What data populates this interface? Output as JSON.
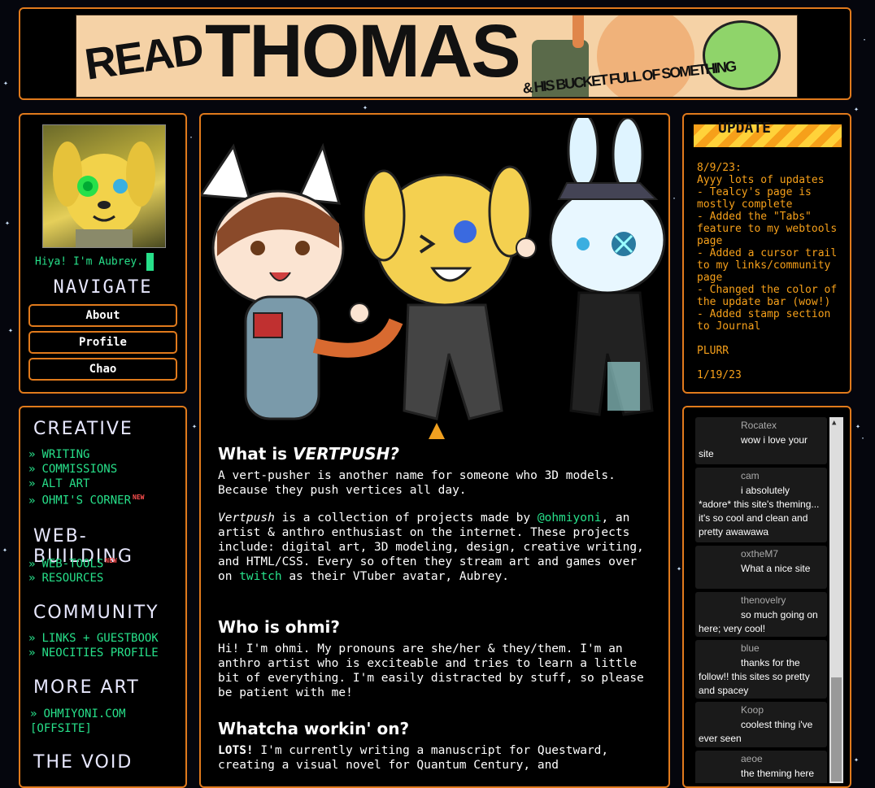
{
  "banner": {
    "read": "READ",
    "thomas": "THOMAS",
    "subtitle": "& HIS BUCKET FULL OF SOMETHING"
  },
  "sidebar": {
    "greeting": "Hiya! I'm Aubrey.",
    "nav_title": "NAVIGATE",
    "nav_buttons": [
      "About",
      "Profile",
      "Chao"
    ]
  },
  "links": {
    "creative_title": "CREATIVE",
    "creative": [
      "WRITING",
      "COMMISSIONS",
      "ALT ART",
      "OHMI'S CORNER"
    ],
    "web_title": "WEB-BUILDING",
    "web": [
      "WEB-TOOLS",
      "RESOURCES"
    ],
    "community_title": "COMMUNITY",
    "community": [
      "LINKS + GUESTBOOK",
      "NEOCITIES PROFILE"
    ],
    "more_title": "MORE ART",
    "more": [
      "OHMIYONI.COM [OFFSITE]"
    ],
    "void_title": "THE VOID",
    "arrow": "»",
    "new_tag": "NEW"
  },
  "main": {
    "h1_prefix": "What is ",
    "h1_em": "VERTPUSH?",
    "p1": "A vert-pusher is another name for someone who 3D models. Because they push vertices all day.",
    "p2_em": "Vertpush",
    "p2_a": " is a collection of projects made by ",
    "p2_link1": "@ohmiyoni",
    "p2_b": ", an artist & anthro enthusiast on the internet. These projects include: digital art, 3D modeling, design, creative writing, and HTML/CSS. Every so often they stream art and games over on ",
    "p2_link2": "twitch",
    "p2_c": " as their VTuber avatar, Aubrey.",
    "h2": "Who is ohmi?",
    "p3": "Hi! I'm ohmi. My pronouns are she/her & they/them. I'm an anthro artist who is exciteable and tries to learn a little bit of everything. I'm easily distracted by stuff, so please be patient with me!",
    "h3": "Whatcha workin' on?",
    "p4_bold": "LOTS!",
    "p4": " I'm currently writing a manuscript for Questward, creating a visual novel for Quantum Century, and"
  },
  "updates": {
    "bar_label": "UPDATE",
    "text": "8/9/23:\nAyyy lots of updates\n- Tealcy's page is mostly complete\n- Added the \"Tabs\" feature to my webtools page\n- Added a cursor trail to my links/community page\n- Changed the color of the update bar (wow!)\n- Added stamp section to Journal\n\nPLURR\n\n1/19/23"
  },
  "guestbook": [
    {
      "name": "Rocatex",
      "msg": "wow i love your site"
    },
    {
      "name": "cam",
      "msg": "i absolutely *adore* this site's theming... it's so cool and clean and pretty awawawa"
    },
    {
      "name": "oxtheM7",
      "msg": "What a nice site"
    },
    {
      "name": "thenovelry",
      "msg": "so much going on here; very cool!"
    },
    {
      "name": "blue",
      "msg": "thanks for the follow!! this sites so pretty and spacey"
    },
    {
      "name": "Koop",
      "msg": "coolest thing i've ever seen"
    },
    {
      "name": "aeoe",
      "msg": "the theming here"
    }
  ],
  "colors": {
    "accent": "#e07a1c",
    "link": "#27e08a",
    "update_text": "#f6a01a"
  }
}
